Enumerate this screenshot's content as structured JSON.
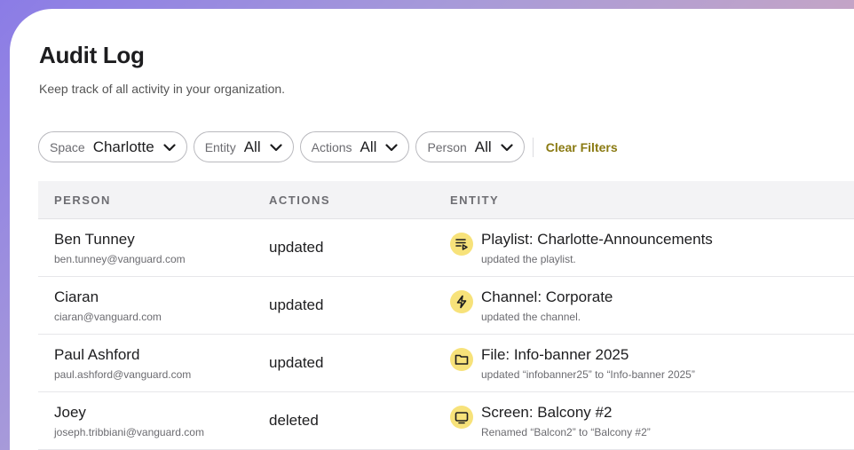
{
  "header": {
    "title": "Audit Log",
    "subtitle": "Keep track of all activity in your organization."
  },
  "filters": [
    {
      "label": "Space",
      "value": "Charlotte"
    },
    {
      "label": "Entity",
      "value": "All"
    },
    {
      "label": "Actions",
      "value": "All"
    },
    {
      "label": "Person",
      "value": "All"
    }
  ],
  "clear_filters_label": "Clear Filters",
  "table": {
    "columns": [
      "PERSON",
      "ACTIONS",
      "ENTITY"
    ],
    "rows": [
      {
        "name": "Ben Tunney",
        "email": "ben.tunney@vanguard.com",
        "action": "updated",
        "entity_icon": "playlist-icon",
        "entity_title": "Playlist: Charlotte-Announcements",
        "entity_desc": "updated the playlist."
      },
      {
        "name": "Ciaran",
        "email": "ciaran@vanguard.com",
        "action": "updated",
        "entity_icon": "lightning-icon",
        "entity_title": "Channel: Corporate",
        "entity_desc": "updated the channel."
      },
      {
        "name": "Paul Ashford",
        "email": "paul.ashford@vanguard.com",
        "action": "updated",
        "entity_icon": "folder-icon",
        "entity_title": "File: Info-banner 2025",
        "entity_desc": "updated “infobanner25” to “Info-banner 2025”"
      },
      {
        "name": "Joey",
        "email": "joseph.tribbiani@vanguard.com",
        "action": "deleted",
        "entity_icon": "screen-icon",
        "entity_title": "Screen: Balcony #2",
        "entity_desc": "Renamed “Balcon2” to “Balcony #2”"
      }
    ]
  },
  "colors": {
    "accent": "#8a7a12",
    "icon_bg": "#f7e27a"
  }
}
